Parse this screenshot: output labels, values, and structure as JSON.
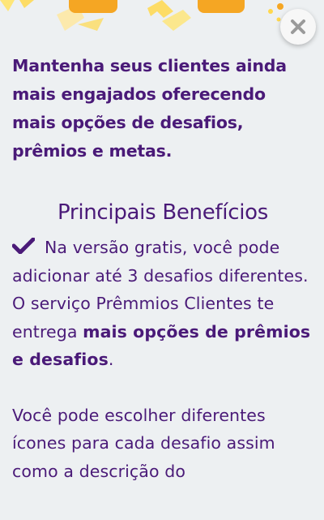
{
  "colors": {
    "background": "#edf0f2",
    "text": "#4a1a78",
    "accent_orange": "#f5a623",
    "accent_yellow": "#ffd84d"
  },
  "icons": {
    "close": "close-icon",
    "check": "check-icon"
  },
  "intro": {
    "text": "Mantenha seus clientes ainda mais engajados oferecendo mais opções de desafios, prêmios e metas."
  },
  "benefits": {
    "title": "Principais Benefícios",
    "item1": {
      "text_before": "Na versão gratis, você pode adicionar até 3 desafios diferentes. O serviço Prêmmios Clientes te entrega ",
      "text_strong": "mais opções de prêmios e desafios",
      "text_after": "."
    },
    "item2": {
      "text": "Você pode escolher diferentes ícones para cada desafio assim como a descrição do"
    }
  }
}
